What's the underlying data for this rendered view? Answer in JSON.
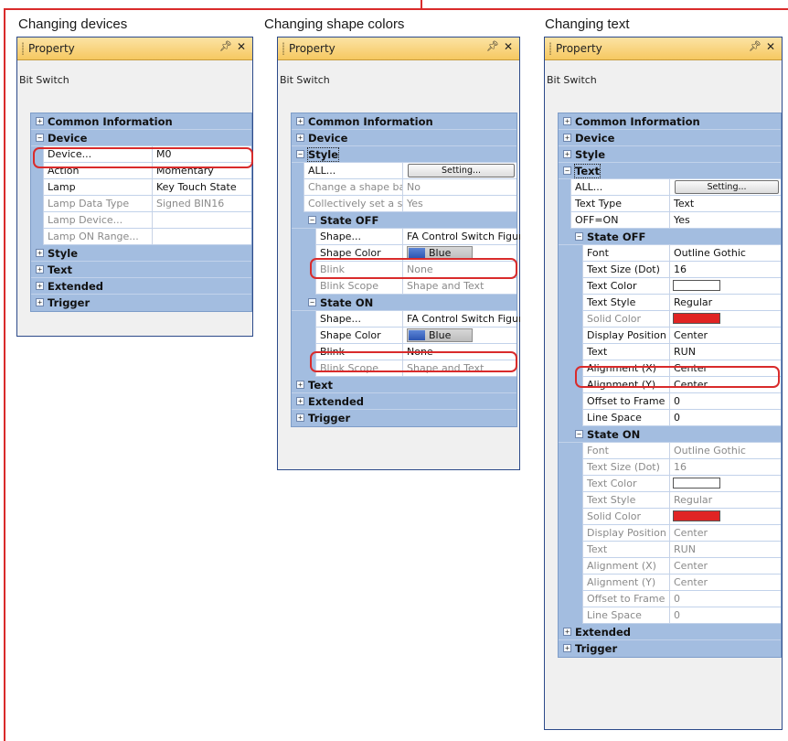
{
  "captions": {
    "devices": "Changing devices",
    "shape_colors": "Changing shape colors",
    "text": "Changing text"
  },
  "panel": {
    "title": "Property",
    "pin_icon": "pin-icon",
    "close_icon": "close-icon",
    "object_name": "Bit Switch"
  },
  "p1": {
    "common": "Common Information",
    "device": "Device",
    "rows": [
      {
        "name": "Device...",
        "value": "M0"
      },
      {
        "name": "Action",
        "value": "Momentary"
      },
      {
        "name": "Lamp",
        "value": "Key Touch State"
      },
      {
        "name": "Lamp Data Type",
        "value": "Signed BIN16"
      },
      {
        "name": "Lamp Device...",
        "value": ""
      },
      {
        "name": "Lamp ON Range...",
        "value": ""
      }
    ],
    "style": "Style",
    "text": "Text",
    "extended": "Extended",
    "trigger": "Trigger"
  },
  "p2": {
    "common": "Common Information",
    "device": "Device",
    "style": "Style",
    "all": "ALL...",
    "setting": "Setting...",
    "change_base": {
      "name": "Change a shape base",
      "value": "No"
    },
    "collectively": {
      "name": "Collectively set a shape",
      "value": "Yes"
    },
    "state_off": "State OFF",
    "state_on": "State ON",
    "off_rows": {
      "shape": {
        "name": "Shape...",
        "value": "FA Control Switch Figure"
      },
      "shape_color": {
        "name": "Shape Color",
        "value": "Blue"
      },
      "blink": {
        "name": "Blink",
        "value": "None"
      },
      "blink_scope": {
        "name": "Blink Scope",
        "value": "Shape and Text"
      }
    },
    "on_rows": {
      "shape": {
        "name": "Shape...",
        "value": "FA Control Switch Figure"
      },
      "shape_color": {
        "name": "Shape Color",
        "value": "Blue"
      },
      "blink": {
        "name": "Blink",
        "value": "None"
      },
      "blink_scope": {
        "name": "Blink Scope",
        "value": "Shape and Text"
      }
    },
    "text": "Text",
    "extended": "Extended",
    "trigger": "Trigger"
  },
  "p3": {
    "common": "Common Information",
    "device": "Device",
    "style": "Style",
    "text": "Text",
    "all": "ALL...",
    "setting": "Setting...",
    "text_type": {
      "name": "Text Type",
      "value": "Text"
    },
    "off_on": {
      "name": "OFF=ON",
      "value": "Yes"
    },
    "state_off": "State OFF",
    "state_on": "State ON",
    "off_rows": [
      {
        "name": "Font",
        "value": "Outline Gothic"
      },
      {
        "name": "Text Size (Dot)",
        "value": "16"
      },
      {
        "name": "Text Color",
        "value": ""
      },
      {
        "name": "Text Style",
        "value": "Regular"
      },
      {
        "name": "Solid Color",
        "value": ""
      },
      {
        "name": "Display Position",
        "value": "Center"
      },
      {
        "name": "Text",
        "value": "RUN"
      },
      {
        "name": "Alignment (X)",
        "value": "Center"
      },
      {
        "name": "Alignment (Y)",
        "value": "Center"
      },
      {
        "name": "Offset to Frame",
        "value": "0"
      },
      {
        "name": "Line Space",
        "value": "0"
      }
    ],
    "on_rows": [
      {
        "name": "Font",
        "value": "Outline Gothic"
      },
      {
        "name": "Text Size (Dot)",
        "value": "16"
      },
      {
        "name": "Text Color",
        "value": ""
      },
      {
        "name": "Text Style",
        "value": "Regular"
      },
      {
        "name": "Solid Color",
        "value": ""
      },
      {
        "name": "Display Position",
        "value": "Center"
      },
      {
        "name": "Text",
        "value": "RUN"
      },
      {
        "name": "Alignment (X)",
        "value": "Center"
      },
      {
        "name": "Alignment (Y)",
        "value": "Center"
      },
      {
        "name": "Offset to Frame",
        "value": "0"
      },
      {
        "name": "Line Space",
        "value": "0"
      }
    ],
    "extended": "Extended",
    "trigger": "Trigger"
  },
  "colors": {
    "highlight": "#d92b2b",
    "text_color_swatch": "#ffffff",
    "solid_color_swatch": "#e02424",
    "shape_color_blue": "#2d56b2"
  }
}
